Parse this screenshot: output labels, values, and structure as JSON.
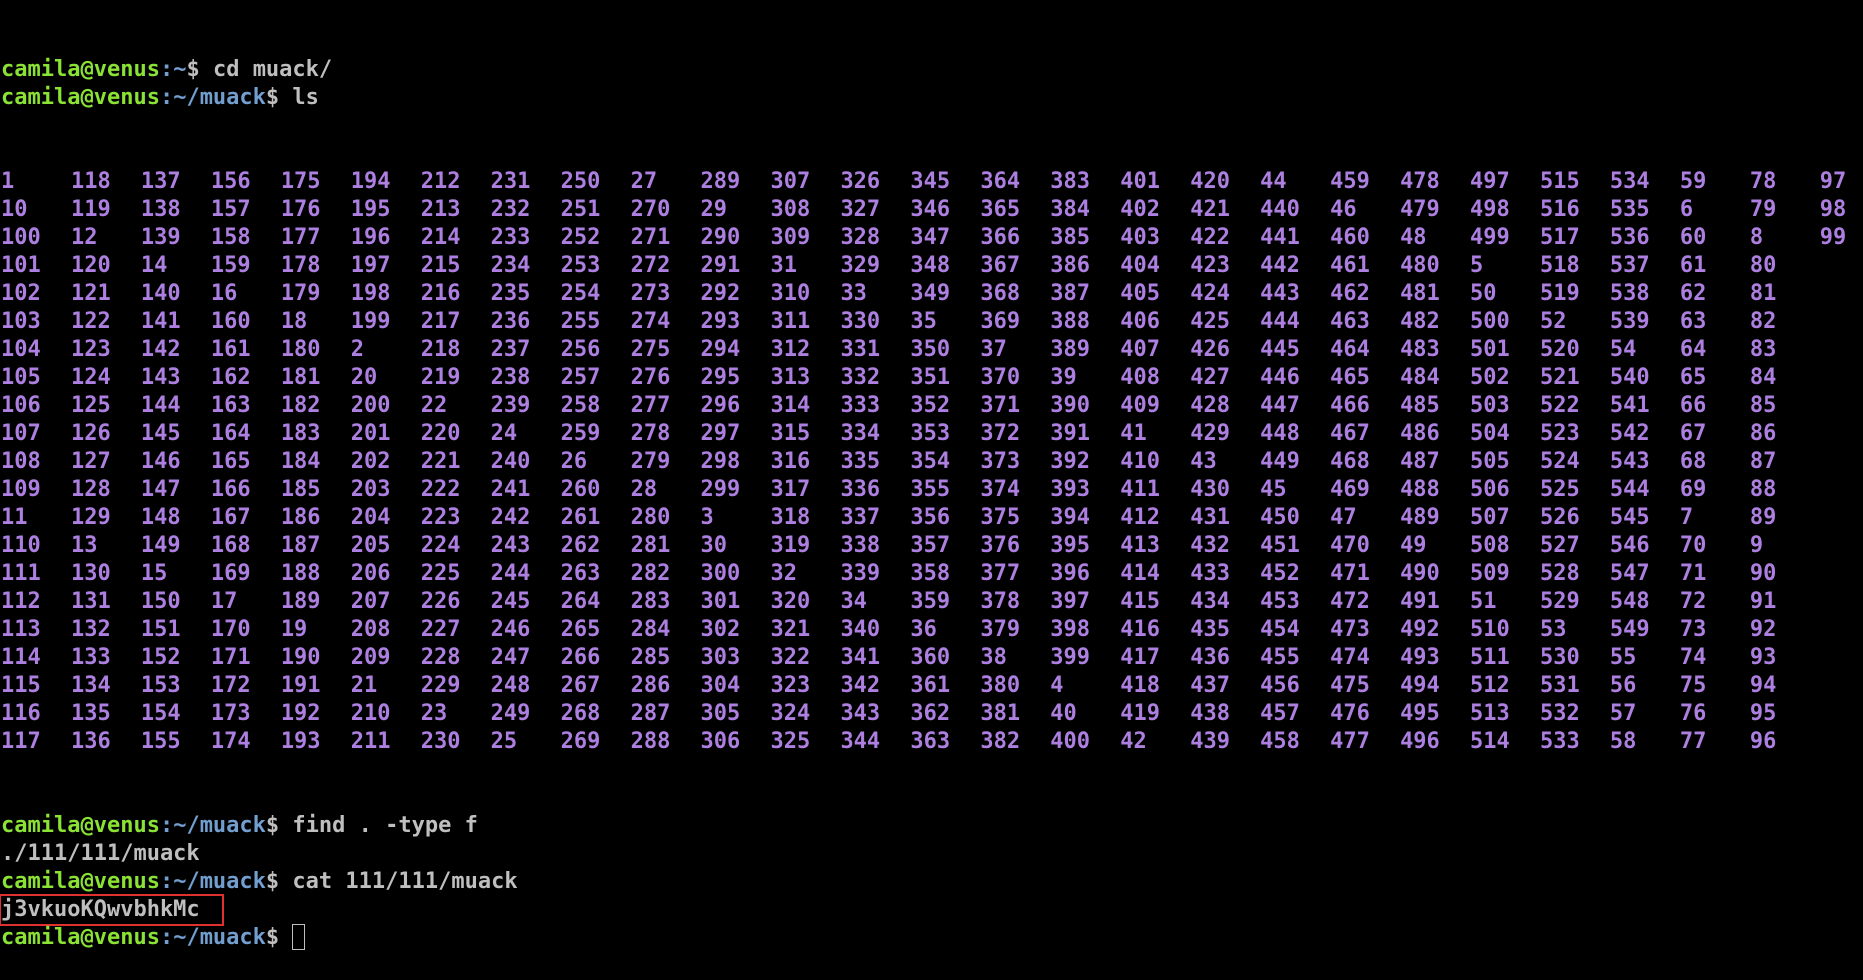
{
  "terminal": {
    "prompt_user": "camila@venus",
    "colors": {
      "user": "#8ae234",
      "path": "#729fcf",
      "ls_dir": "#ad7fe0",
      "text": "#bfbfbf",
      "highlight": "#e03030",
      "background": "#000000"
    },
    "lines": [
      {
        "type": "prompt",
        "path": ":~",
        "sym": "$ ",
        "cmd": "cd muack/"
      },
      {
        "type": "prompt",
        "path": ":~/muack",
        "sym": "$ ",
        "cmd": "ls"
      }
    ],
    "ls_columns": [
      [
        "1",
        "10",
        "100",
        "101",
        "102",
        "103",
        "104",
        "105",
        "106",
        "107",
        "108",
        "109",
        "11",
        "110",
        "111",
        "112",
        "113",
        "114",
        "115",
        "116",
        "117"
      ],
      [
        "118",
        "119",
        "12",
        "120",
        "121",
        "122",
        "123",
        "124",
        "125",
        "126",
        "127",
        "128",
        "129",
        "13",
        "130",
        "131",
        "132",
        "133",
        "134",
        "135",
        "136"
      ],
      [
        "137",
        "138",
        "139",
        "14",
        "140",
        "141",
        "142",
        "143",
        "144",
        "145",
        "146",
        "147",
        "148",
        "149",
        "15",
        "150",
        "151",
        "152",
        "153",
        "154",
        "155"
      ],
      [
        "156",
        "157",
        "158",
        "159",
        "16",
        "160",
        "161",
        "162",
        "163",
        "164",
        "165",
        "166",
        "167",
        "168",
        "169",
        "17",
        "170",
        "171",
        "172",
        "173",
        "174"
      ],
      [
        "175",
        "176",
        "177",
        "178",
        "179",
        "18",
        "180",
        "181",
        "182",
        "183",
        "184",
        "185",
        "186",
        "187",
        "188",
        "189",
        "19",
        "190",
        "191",
        "192",
        "193"
      ],
      [
        "194",
        "195",
        "196",
        "197",
        "198",
        "199",
        "2",
        "20",
        "200",
        "201",
        "202",
        "203",
        "204",
        "205",
        "206",
        "207",
        "208",
        "209",
        "21",
        "210",
        "211"
      ],
      [
        "212",
        "213",
        "214",
        "215",
        "216",
        "217",
        "218",
        "219",
        "22",
        "220",
        "221",
        "222",
        "223",
        "224",
        "225",
        "226",
        "227",
        "228",
        "229",
        "23",
        "230"
      ],
      [
        "231",
        "232",
        "233",
        "234",
        "235",
        "236",
        "237",
        "238",
        "239",
        "24",
        "240",
        "241",
        "242",
        "243",
        "244",
        "245",
        "246",
        "247",
        "248",
        "249",
        "25"
      ],
      [
        "250",
        "251",
        "252",
        "253",
        "254",
        "255",
        "256",
        "257",
        "258",
        "259",
        "26",
        "260",
        "261",
        "262",
        "263",
        "264",
        "265",
        "266",
        "267",
        "268",
        "269"
      ],
      [
        "27",
        "270",
        "271",
        "272",
        "273",
        "274",
        "275",
        "276",
        "277",
        "278",
        "279",
        "28",
        "280",
        "281",
        "282",
        "283",
        "284",
        "285",
        "286",
        "287",
        "288"
      ],
      [
        "289",
        "29",
        "290",
        "291",
        "292",
        "293",
        "294",
        "295",
        "296",
        "297",
        "298",
        "299",
        "3",
        "30",
        "300",
        "301",
        "302",
        "303",
        "304",
        "305",
        "306"
      ],
      [
        "307",
        "308",
        "309",
        "31",
        "310",
        "311",
        "312",
        "313",
        "314",
        "315",
        "316",
        "317",
        "318",
        "319",
        "32",
        "320",
        "321",
        "322",
        "323",
        "324",
        "325"
      ],
      [
        "326",
        "327",
        "328",
        "329",
        "33",
        "330",
        "331",
        "332",
        "333",
        "334",
        "335",
        "336",
        "337",
        "338",
        "339",
        "34",
        "340",
        "341",
        "342",
        "343",
        "344"
      ],
      [
        "345",
        "346",
        "347",
        "348",
        "349",
        "35",
        "350",
        "351",
        "352",
        "353",
        "354",
        "355",
        "356",
        "357",
        "358",
        "359",
        "36",
        "360",
        "361",
        "362",
        "363"
      ],
      [
        "364",
        "365",
        "366",
        "367",
        "368",
        "369",
        "37",
        "370",
        "371",
        "372",
        "373",
        "374",
        "375",
        "376",
        "377",
        "378",
        "379",
        "38",
        "380",
        "381",
        "382"
      ],
      [
        "383",
        "384",
        "385",
        "386",
        "387",
        "388",
        "389",
        "39",
        "390",
        "391",
        "392",
        "393",
        "394",
        "395",
        "396",
        "397",
        "398",
        "399",
        "4",
        "40",
        "400"
      ],
      [
        "401",
        "402",
        "403",
        "404",
        "405",
        "406",
        "407",
        "408",
        "409",
        "41",
        "410",
        "411",
        "412",
        "413",
        "414",
        "415",
        "416",
        "417",
        "418",
        "419",
        "42"
      ],
      [
        "420",
        "421",
        "422",
        "423",
        "424",
        "425",
        "426",
        "427",
        "428",
        "429",
        "43",
        "430",
        "431",
        "432",
        "433",
        "434",
        "435",
        "436",
        "437",
        "438",
        "439"
      ],
      [
        "44",
        "440",
        "441",
        "442",
        "443",
        "444",
        "445",
        "446",
        "447",
        "448",
        "449",
        "45",
        "450",
        "451",
        "452",
        "453",
        "454",
        "455",
        "456",
        "457",
        "458"
      ],
      [
        "459",
        "46",
        "460",
        "461",
        "462",
        "463",
        "464",
        "465",
        "466",
        "467",
        "468",
        "469",
        "47",
        "470",
        "471",
        "472",
        "473",
        "474",
        "475",
        "476",
        "477"
      ],
      [
        "478",
        "479",
        "48",
        "480",
        "481",
        "482",
        "483",
        "484",
        "485",
        "486",
        "487",
        "488",
        "489",
        "49",
        "490",
        "491",
        "492",
        "493",
        "494",
        "495",
        "496"
      ],
      [
        "497",
        "498",
        "499",
        "5",
        "50",
        "500",
        "501",
        "502",
        "503",
        "504",
        "505",
        "506",
        "507",
        "508",
        "509",
        "51",
        "510",
        "511",
        "512",
        "513",
        "514"
      ],
      [
        "515",
        "516",
        "517",
        "518",
        "519",
        "52",
        "520",
        "521",
        "522",
        "523",
        "524",
        "525",
        "526",
        "527",
        "528",
        "529",
        "53",
        "530",
        "531",
        "532",
        "533"
      ],
      [
        "534",
        "535",
        "536",
        "537",
        "538",
        "539",
        "54",
        "540",
        "541",
        "542",
        "543",
        "544",
        "545",
        "546",
        "547",
        "548",
        "549",
        "55",
        "56",
        "57",
        "58"
      ],
      [
        "59",
        "6",
        "60",
        "61",
        "62",
        "63",
        "64",
        "65",
        "66",
        "67",
        "68",
        "69",
        "7",
        "70",
        "71",
        "72",
        "73",
        "74",
        "75",
        "76",
        "77"
      ],
      [
        "78",
        "79",
        "8",
        "80",
        "81",
        "82",
        "83",
        "84",
        "85",
        "86",
        "87",
        "88",
        "89",
        "9",
        "90",
        "91",
        "92",
        "93",
        "94",
        "95",
        "96"
      ],
      [
        "97",
        "98",
        "99",
        "",
        "",
        "",
        "",
        "",
        "",
        "",
        "",
        "",
        "",
        "",
        "",
        "",
        "",
        "",
        "",
        "",
        ""
      ]
    ],
    "after_ls": [
      {
        "type": "prompt",
        "path": ":~/muack",
        "sym": "$ ",
        "cmd": "find . -type f"
      },
      {
        "type": "output",
        "text": "./111/111/muack"
      },
      {
        "type": "prompt",
        "path": ":~/muack",
        "sym": "$ ",
        "cmd": "cat 111/111/muack"
      },
      {
        "type": "highlighted_output",
        "text": "j3vkuoKQwvbhkMc"
      },
      {
        "type": "prompt_cursor",
        "path": ":~/muack",
        "sym": "$ ",
        "cmd": ""
      }
    ]
  }
}
